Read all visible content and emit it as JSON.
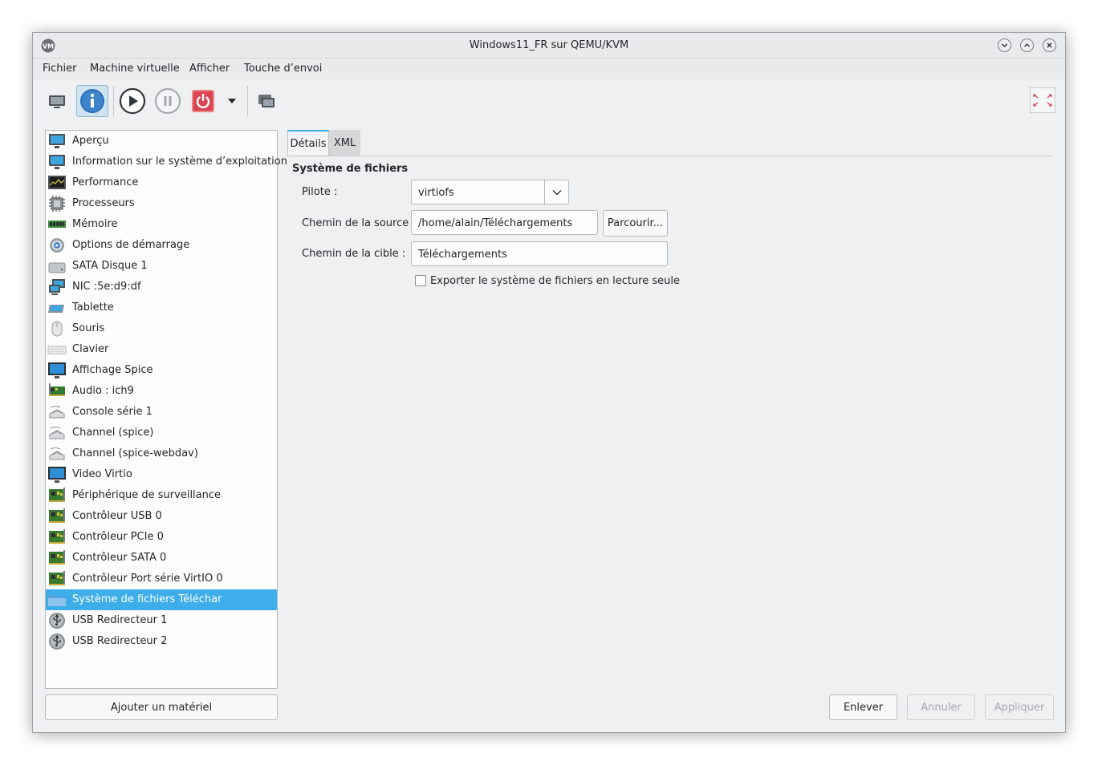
{
  "window": {
    "title": "Windows11_FR sur QEMU/KVM"
  },
  "menubar": {
    "items": [
      "Fichier",
      "Machine virtuelle",
      "Afficher",
      "Touche d’envoi"
    ]
  },
  "devices": [
    {
      "label": "Aperçu",
      "icon": "monitor-icon"
    },
    {
      "label": "Information sur le système d’exploitation",
      "icon": "monitor-icon"
    },
    {
      "label": "Performance",
      "icon": "performance-graph-icon"
    },
    {
      "label": "Processeurs",
      "icon": "cpu-icon"
    },
    {
      "label": "Mémoire",
      "icon": "memory-icon"
    },
    {
      "label": "Options de démarrage",
      "icon": "gear-icon"
    },
    {
      "label": "SATA Disque 1",
      "icon": "disk-icon"
    },
    {
      "label": "NIC :5e:d9:df",
      "icon": "network-icon"
    },
    {
      "label": "Tablette",
      "icon": "tablet-icon"
    },
    {
      "label": "Souris",
      "icon": "mouse-icon"
    },
    {
      "label": "Clavier",
      "icon": "keyboard-icon"
    },
    {
      "label": "Affichage Spice",
      "icon": "display-icon"
    },
    {
      "label": "Audio : ich9",
      "icon": "audio-card-icon"
    },
    {
      "label": "Console série 1",
      "icon": "serial-icon"
    },
    {
      "label": "Channel (spice)",
      "icon": "serial-icon"
    },
    {
      "label": "Channel (spice-webdav)",
      "icon": "serial-icon"
    },
    {
      "label": "Video Virtio",
      "icon": "display-icon"
    },
    {
      "label": "Périphérique de surveillance",
      "icon": "pci-card-icon"
    },
    {
      "label": "Contrôleur USB 0",
      "icon": "pci-card-icon"
    },
    {
      "label": "Contrôleur PCIe 0",
      "icon": "pci-card-icon"
    },
    {
      "label": "Contrôleur SATA 0",
      "icon": "pci-card-icon"
    },
    {
      "label": "Contrôleur Port série VirtIO 0",
      "icon": "pci-card-icon"
    },
    {
      "label": "Système de fichiers Téléchar",
      "icon": "folder-icon",
      "selected": true
    },
    {
      "label": "USB Redirecteur 1",
      "icon": "usb-icon"
    },
    {
      "label": "USB Redirecteur 2",
      "icon": "usb-icon"
    }
  ],
  "buttons": {
    "add_hardware": "Ajouter un matériel",
    "remove": "Enlever",
    "cancel": "Annuler",
    "apply": "Appliquer",
    "browse": "Parcourir..."
  },
  "tabs": [
    "Détails",
    "XML"
  ],
  "details": {
    "section_title": "Système de fichiers",
    "driver_label": "Pilote :",
    "driver_value": "virtiofs",
    "source_label": "Chemin de la source :",
    "source_value": "/home/alain/Téléchargements",
    "target_label": "Chemin de la cible :",
    "target_value": "Téléchargements",
    "readonly_label": "Exporter le système de fichiers en lecture seule",
    "readonly_checked": false
  },
  "colors": {
    "selection": "#3daee9",
    "shutdown_button": "#da4453"
  }
}
